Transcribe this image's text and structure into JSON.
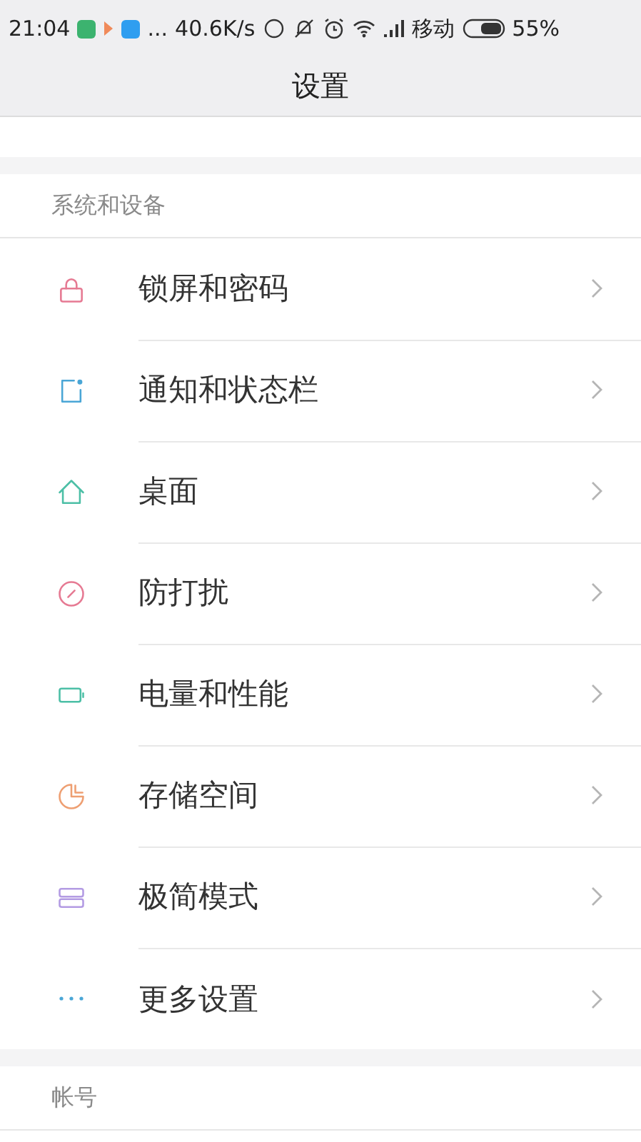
{
  "status_bar": {
    "time": "21:04",
    "ellipsis": "...",
    "speed": "40.6K/s",
    "carrier": "移动",
    "battery": "55%"
  },
  "title": "设置",
  "sections": [
    {
      "header": "系统和设备",
      "items": [
        {
          "label": "锁屏和密码",
          "kind": "lock",
          "color": "#e67a93"
        },
        {
          "label": "通知和状态栏",
          "kind": "notification",
          "color": "#4aa6d6"
        },
        {
          "label": "桌面",
          "kind": "home",
          "color": "#4cbfa6"
        },
        {
          "label": "防打扰",
          "kind": "dnd",
          "color": "#e67a93"
        },
        {
          "label": "电量和性能",
          "kind": "battery",
          "color": "#4cbfa6"
        },
        {
          "label": "存储空间",
          "kind": "storage",
          "color": "#ee9f72"
        },
        {
          "label": "极简模式",
          "kind": "simple",
          "color": "#b39be3"
        },
        {
          "label": "更多设置",
          "kind": "more",
          "color": "#4aa6d6"
        }
      ]
    },
    {
      "header": "帐号"
    }
  ]
}
